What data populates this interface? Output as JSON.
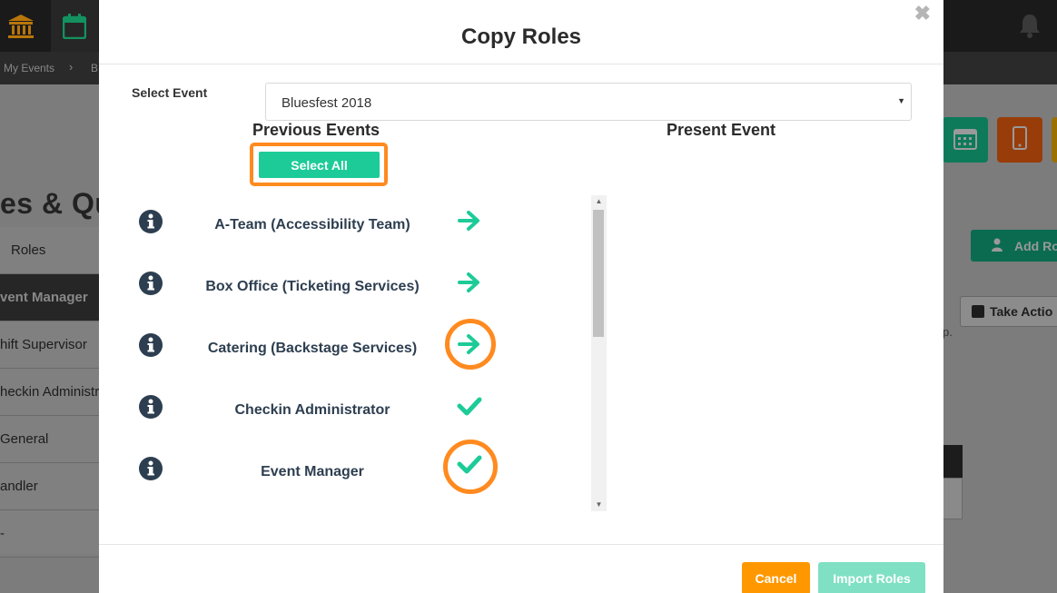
{
  "background": {
    "breadcrumb": [
      "My Events",
      "B"
    ],
    "breadcrumb_sep": "›",
    "page_title": "es & Qu",
    "sidebar_items": [
      "Roles",
      "vent Manager",
      "hift Supervisor",
      "heckin Administra",
      "General",
      "andler",
      "-"
    ],
    "add_role_label": "Add Ro",
    "take_action_label": "Take Actio",
    "partial_text": "p."
  },
  "modal": {
    "title": "Copy Roles",
    "close_glyph": "✖",
    "select_event_label": "Select Event",
    "select_event_value": "Bluesfest 2018",
    "previous_events_heading": "Previous Events",
    "present_event_heading": "Present Event",
    "select_all_label": "Select All",
    "roles": [
      {
        "name": "A-Team (Accessibility Team)",
        "action": "arrow"
      },
      {
        "name": "Box Office (Ticketing Services)",
        "action": "arrow"
      },
      {
        "name": "Catering (Backstage Services)",
        "action": "arrow"
      },
      {
        "name": "Checkin Administrator",
        "action": "check"
      },
      {
        "name": "Event Manager",
        "action": "check"
      }
    ],
    "cancel_label": "Cancel",
    "import_label": "Import Roles"
  },
  "colors": {
    "accent_green": "#1dcb98",
    "highlight_orange": "#ff8a1f",
    "cancel_orange": "#ff9800",
    "import_disabled": "#7fe0c4",
    "info_icon": "#2d3e50"
  },
  "icons": [
    "bank-icon",
    "calendar-icon",
    "bell-icon",
    "info-icon",
    "arrow-right-icon",
    "check-icon",
    "close-icon",
    "mobile-icon",
    "user-icon"
  ]
}
